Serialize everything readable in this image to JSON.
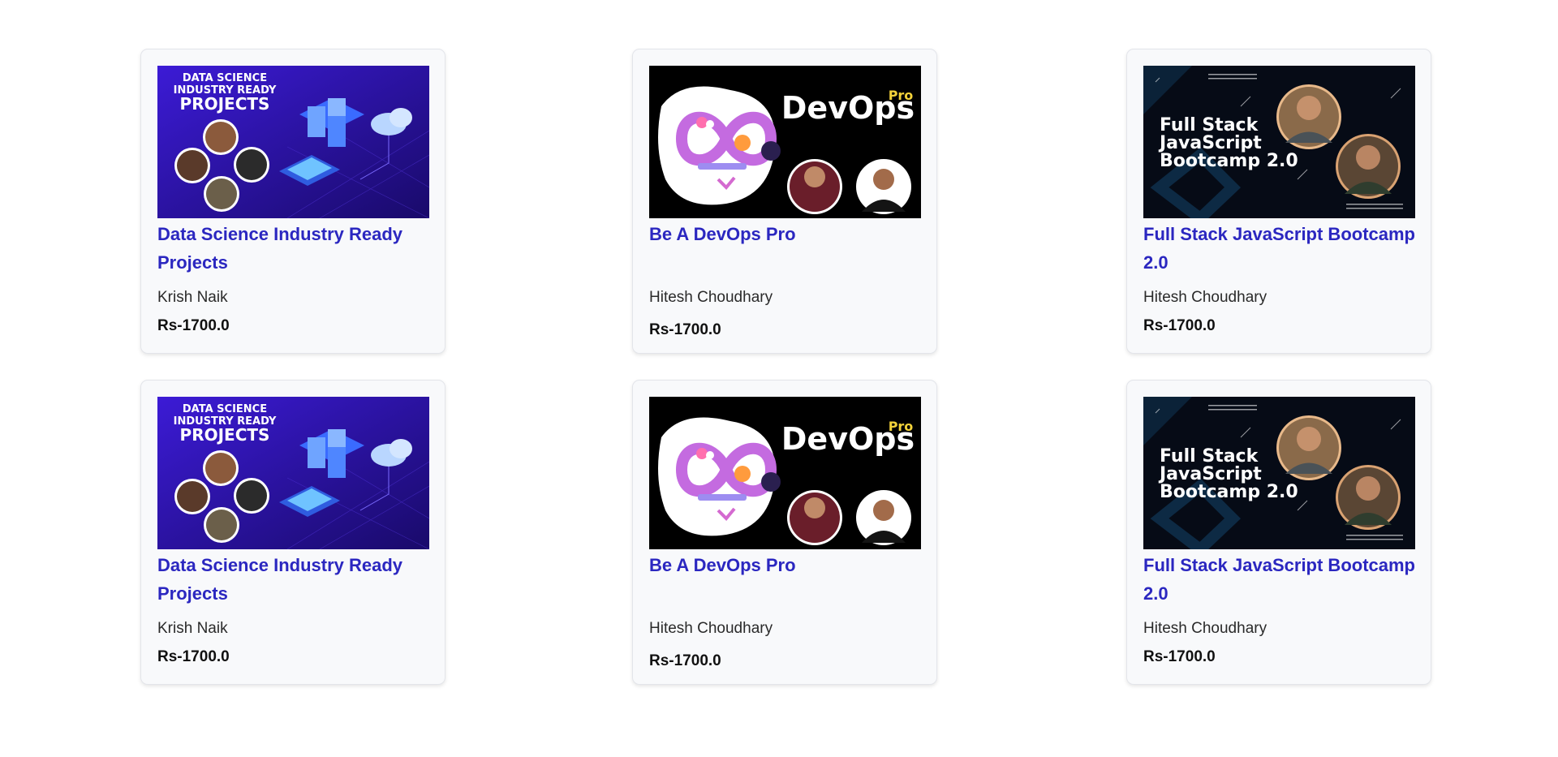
{
  "courses": [
    {
      "title": "Data Science Industry Ready Projects",
      "author": "Krish Naik",
      "price": "Rs-1700.0",
      "thumb": {
        "lines": [
          "DATA SCIENCE",
          "INDUSTRY READY",
          "PROJECTS"
        ],
        "icon": "server-cloud-illustration"
      }
    },
    {
      "title": "Be A DevOps Pro",
      "author": "Hitesh Choudhary",
      "price": "Rs-1700.0",
      "thumb": {
        "brand": "DevOps",
        "badge": "Pro",
        "icon": "infinity-loop-illustration"
      }
    },
    {
      "title": "Full Stack JavaScript Bootcamp 2.0",
      "author": "Hitesh Choudhary",
      "price": "Rs-1700.0",
      "thumb": {
        "lines": [
          "Full Stack",
          "JavaScript",
          "Bootcamp 2.0"
        ],
        "icon": "portrait-circles"
      }
    },
    {
      "title": "Data Science Industry Ready Projects",
      "author": "Krish Naik",
      "price": "Rs-1700.0",
      "thumb": {
        "lines": [
          "DATA SCIENCE",
          "INDUSTRY READY",
          "PROJECTS"
        ],
        "icon": "server-cloud-illustration"
      }
    },
    {
      "title": "Be A DevOps Pro",
      "author": "Hitesh Choudhary",
      "price": "Rs-1700.0",
      "thumb": {
        "brand": "DevOps",
        "badge": "Pro",
        "icon": "infinity-loop-illustration"
      }
    },
    {
      "title": "Full Stack JavaScript Bootcamp 2.0",
      "author": "Hitesh Choudhary",
      "price": "Rs-1700.0",
      "thumb": {
        "lines": [
          "Full Stack",
          "JavaScript",
          "Bootcamp 2.0"
        ],
        "icon": "portrait-circles"
      }
    }
  ],
  "colors": {
    "title": "#2b27c0",
    "card_bg": "#f8f9fb",
    "ds_gradient_start": "#3c1bd6",
    "ds_gradient_end": "#1a0a6e",
    "devops_bg": "#000000",
    "devops_pro": "#f3d23a",
    "fs_bg": "#060b16"
  }
}
